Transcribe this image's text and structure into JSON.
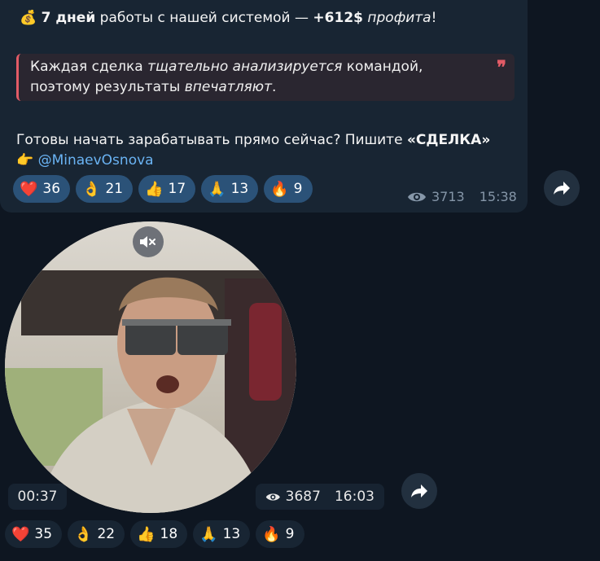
{
  "post": {
    "line1": {
      "emoji": "💰",
      "bold_days": "7 дней",
      "middle": " работы с нашей системой — ",
      "bold_profit": "+612$",
      "space": " ",
      "italic_word": "профита",
      "end": "!"
    },
    "quote": {
      "p1": "Каждая сделка ",
      "italic1": "тщательно анализируется",
      "p2": " командой,",
      "p3": "поэтому результаты ",
      "italic2": "впечатляют",
      "p4": ".",
      "mark": "❞"
    },
    "cta": {
      "text": "Готовы начать зарабатывать прямо сейчас? Пишите ",
      "bold": "«СДЕЛКА»"
    },
    "handle_line": {
      "emoji": "👉",
      "handle": "@MinaevOsnova"
    },
    "reactions": [
      {
        "emoji": "❤️",
        "count": "36"
      },
      {
        "emoji": "👌",
        "count": "21"
      },
      {
        "emoji": "👍",
        "count": "17"
      },
      {
        "emoji": "🙏",
        "count": "13"
      },
      {
        "emoji": "🔥",
        "count": "9"
      }
    ],
    "views": "3713",
    "time": "15:38"
  },
  "video_message": {
    "duration": "00:37",
    "views": "3687",
    "time": "16:03",
    "reactions": [
      {
        "emoji": "❤️",
        "count": "35"
      },
      {
        "emoji": "👌",
        "count": "22"
      },
      {
        "emoji": "👍",
        "count": "18"
      },
      {
        "emoji": "🙏",
        "count": "13"
      },
      {
        "emoji": "🔥",
        "count": "9"
      }
    ]
  },
  "icons": {
    "views": "eye-icon",
    "forward": "forward-arrow-icon",
    "mute": "speaker-muted-icon"
  },
  "colors": {
    "background": "#0e1621",
    "bubble": "#182533",
    "link": "#6ab3f3",
    "quote_accent": "#e25b66",
    "reaction_bg": "#2b5278",
    "meta": "#8596a8"
  }
}
